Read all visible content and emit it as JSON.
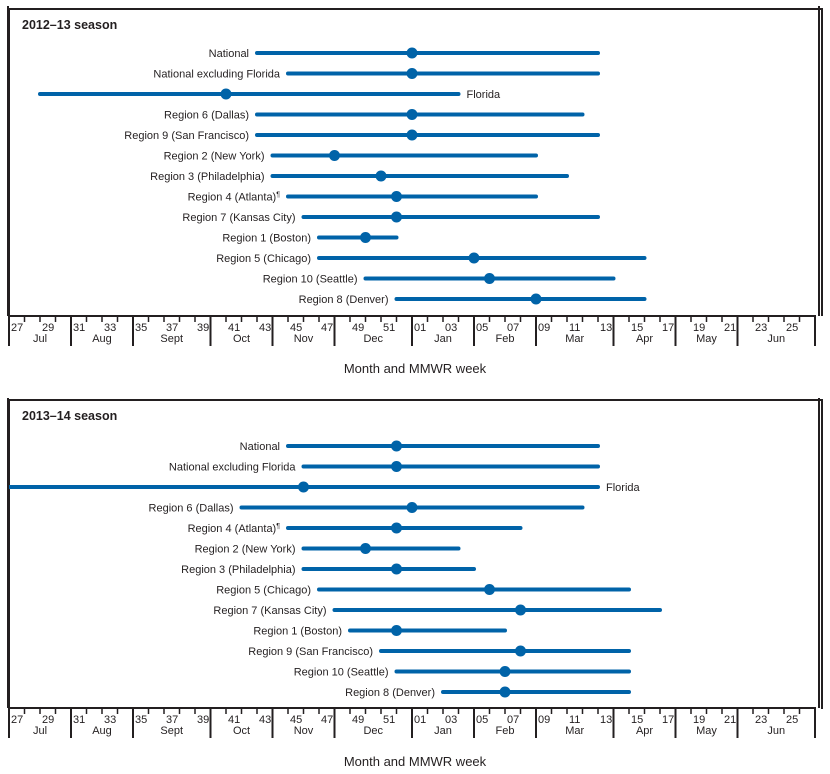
{
  "colors": {
    "series": "#0063a8",
    "axis": "#231f20",
    "text": "#231f20"
  },
  "chart_data": [
    {
      "type": "range-dot",
      "title": "2012–13 season",
      "xlabel": "Month and  MMWR week",
      "x_weeks": [
        "27",
        "28",
        "29",
        "30",
        "31",
        "32",
        "33",
        "34",
        "35",
        "36",
        "37",
        "38",
        "39",
        "40",
        "41",
        "42",
        "43",
        "44",
        "45",
        "46",
        "47",
        "48",
        "49",
        "50",
        "51",
        "52",
        "01",
        "02",
        "03",
        "04",
        "05",
        "06",
        "07",
        "08",
        "09",
        "10",
        "11",
        "12",
        "13",
        "14",
        "15",
        "16",
        "17",
        "18",
        "19",
        "20",
        "21",
        "22",
        "23",
        "24",
        "25",
        "26"
      ],
      "tick_labels": [
        "27",
        "29",
        "31",
        "33",
        "35",
        "37",
        "39",
        "41",
        "43",
        "45",
        "47",
        "49",
        "51",
        "01",
        "03",
        "05",
        "07",
        "09",
        "11",
        "13",
        "15",
        "17",
        "19",
        "21",
        "23",
        "25"
      ],
      "months": [
        {
          "label": "Jul",
          "start": "27",
          "end": "30"
        },
        {
          "label": "Aug",
          "start": "31",
          "end": "34"
        },
        {
          "label": "Sept",
          "start": "35",
          "end": "39"
        },
        {
          "label": "Oct",
          "start": "40",
          "end": "43"
        },
        {
          "label": "Nov",
          "start": "44",
          "end": "47"
        },
        {
          "label": "Dec",
          "start": "48",
          "end": "52"
        },
        {
          "label": "Jan",
          "start": "01",
          "end": "04"
        },
        {
          "label": "Feb",
          "start": "05",
          "end": "08"
        },
        {
          "label": "Mar",
          "start": "09",
          "end": "13"
        },
        {
          "label": "Apr",
          "start": "14",
          "end": "17"
        },
        {
          "label": "May",
          "start": "18",
          "end": "21"
        },
        {
          "label": "Jun",
          "start": "22",
          "end": "26"
        }
      ],
      "series": [
        {
          "name": "National",
          "start": "43",
          "peak": "01",
          "end": "13",
          "label_side": "left"
        },
        {
          "name": "National excluding Florida",
          "start": "45",
          "peak": "01",
          "end": "13",
          "label_side": "left"
        },
        {
          "name": "Florida",
          "start": "29",
          "peak": "41",
          "end": "04",
          "label_side": "right"
        },
        {
          "name": "Region 6 (Dallas)",
          "start": "43",
          "peak": "01",
          "end": "12",
          "label_side": "left"
        },
        {
          "name": "Region 9 (San Francisco)",
          "start": "43",
          "peak": "01",
          "end": "13",
          "label_side": "left"
        },
        {
          "name": "Region 2 (New York)",
          "start": "44",
          "peak": "48",
          "end": "09",
          "label_side": "left"
        },
        {
          "name": "Region 3 (Philadelphia)",
          "start": "44",
          "peak": "51",
          "end": "11",
          "label_side": "left"
        },
        {
          "name": "Region 4 (Atlanta)",
          "footnote": "¶",
          "start": "45",
          "peak": "52",
          "end": "09",
          "label_side": "left"
        },
        {
          "name": "Region 7 (Kansas City)",
          "start": "46",
          "peak": "52",
          "end": "13",
          "label_side": "left"
        },
        {
          "name": "Region 1 (Boston)",
          "start": "47",
          "peak": "50",
          "end": "52",
          "label_side": "left"
        },
        {
          "name": "Region 5 (Chicago)",
          "start": "47",
          "peak": "05",
          "end": "16",
          "label_side": "left"
        },
        {
          "name": "Region 10 (Seattle)",
          "start": "50",
          "peak": "06",
          "end": "14",
          "label_side": "left"
        },
        {
          "name": "Region 8 (Denver)",
          "start": "52",
          "peak": "09",
          "end": "16",
          "label_side": "left"
        }
      ]
    },
    {
      "type": "range-dot",
      "title": "2013–14 season",
      "xlabel": "Month and  MMWR week",
      "series": [
        {
          "name": "National",
          "start": "45",
          "peak": "52",
          "end": "13",
          "label_side": "left"
        },
        {
          "name": "National excluding Florida",
          "start": "46",
          "peak": "52",
          "end": "13",
          "label_side": "left"
        },
        {
          "name": "Florida",
          "start": "27",
          "peak": "46",
          "end": "13",
          "label_side": "right"
        },
        {
          "name": "Region 6 (Dallas)",
          "start": "42",
          "peak": "01",
          "end": "12",
          "label_side": "left"
        },
        {
          "name": "Region 4 (Atlanta)",
          "footnote": "¶",
          "start": "45",
          "peak": "52",
          "end": "08",
          "label_side": "left"
        },
        {
          "name": "Region 2 (New York)",
          "start": "46",
          "peak": "50",
          "end": "04",
          "label_side": "left"
        },
        {
          "name": "Region 3 (Philadelphia)",
          "start": "46",
          "peak": "52",
          "end": "05",
          "label_side": "left"
        },
        {
          "name": "Region 5 (Chicago)",
          "start": "47",
          "peak": "06",
          "end": "15",
          "label_side": "left"
        },
        {
          "name": "Region 7 (Kansas City)",
          "start": "48",
          "peak": "08",
          "end": "17",
          "label_side": "left"
        },
        {
          "name": "Region 1 (Boston)",
          "start": "49",
          "peak": "52",
          "end": "07",
          "label_side": "left"
        },
        {
          "name": "Region 9 (San Francisco)",
          "start": "51",
          "peak": "08",
          "end": "15",
          "label_side": "left"
        },
        {
          "name": "Region 10 (Seattle)",
          "start": "52",
          "peak": "07",
          "end": "15",
          "label_side": "left"
        },
        {
          "name": "Region 8 (Denver)",
          "start": "03",
          "peak": "07",
          "end": "15",
          "label_side": "left"
        }
      ]
    }
  ]
}
